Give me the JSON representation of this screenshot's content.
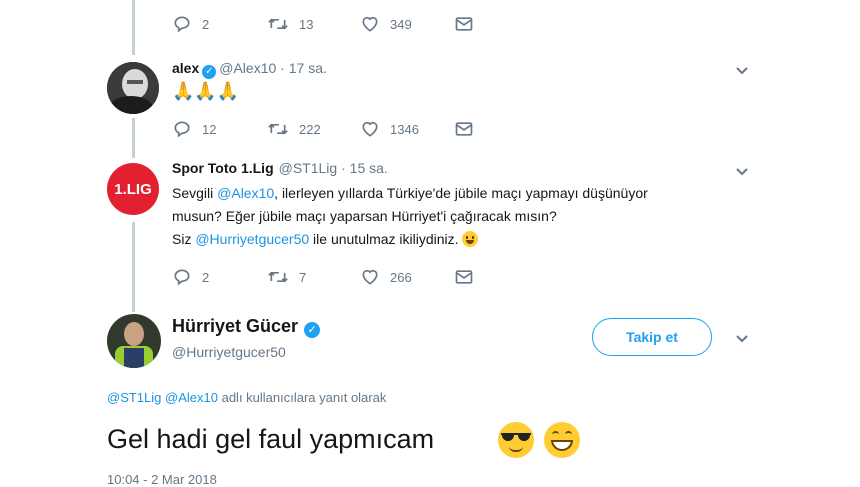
{
  "top_tweet": {
    "replies": "2",
    "retweets": "13",
    "likes": "349"
  },
  "alex_tweet": {
    "name": "alex",
    "handle": "@Alex10",
    "time": "17 sa.",
    "text": "🙏🙏🙏",
    "replies": "12",
    "retweets": "222",
    "likes": "1346"
  },
  "spor_tweet": {
    "name": "Spor Toto 1.Lig",
    "handle": "@ST1Lig",
    "time": "15 sa.",
    "avatar_text": "1.LIG",
    "line1_a": "Sevgili ",
    "line1_mention": "@Alex10",
    "line1_b": ", ilerleyen yıllarda Türkiye'de jübile maçı yapmayı düşünüyor",
    "line2": "musun? Eğer jübile maçı yaparsan Hürriyet'i çağıracak mısın?",
    "line3_a": "Siz ",
    "line3_mention": "@Hurriyetgucer50",
    "line3_b": " ile unutulmaz ikiliydiniz. ",
    "replies": "2",
    "retweets": "7",
    "likes": "266"
  },
  "main_tweet": {
    "name": "Hürriyet Gücer",
    "handle": "@Hurriyetgucer50",
    "follow_label": "Takip et",
    "reply_to_mention1": "@ST1Lig",
    "reply_to_mention2": "@Alex10",
    "reply_to_suffix": "adlı kullanıcılara yanıt olarak",
    "text": "Gel hadi gel faul yapmıcam",
    "timestamp": "10:04 - 2 Mar 2018"
  },
  "colors": {
    "accent": "#1da1f2",
    "mention": "#1b95e0",
    "muted": "#657786",
    "thread": "#c4cfd6",
    "lig_red": "#e3202f"
  }
}
